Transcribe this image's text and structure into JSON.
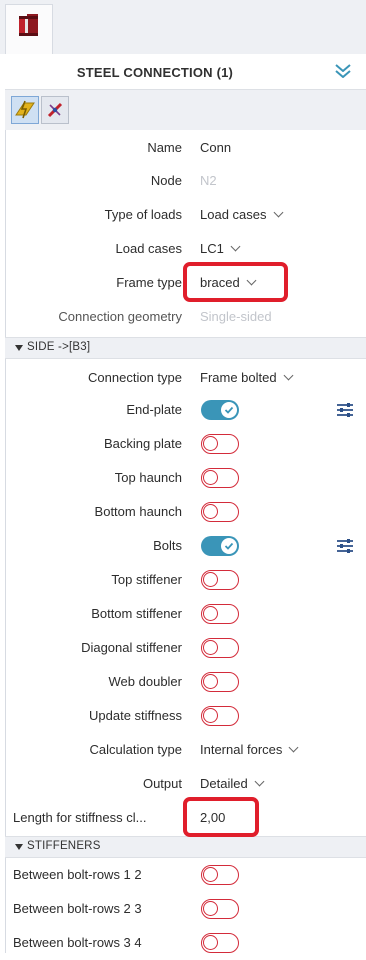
{
  "app": {
    "title": "STEEL CONNECTION (1)",
    "tab_icon": "steel-connection-icon",
    "collapse_icon": "chevron-collapse-icon",
    "accent_color": "#3a95b8",
    "highlight_color": "#e01e2b",
    "off_toggle_color": "#d32b3a"
  },
  "toolbar": {
    "buttons": [
      {
        "icon": "load-icon",
        "active": true
      },
      {
        "icon": "connection-pin-icon",
        "active": false
      }
    ]
  },
  "general": {
    "name": {
      "label": "Name",
      "value": "Conn"
    },
    "node": {
      "label": "Node",
      "value": "N2"
    },
    "type_of_loads": {
      "label": "Type of loads",
      "value": "Load cases"
    },
    "load_cases": {
      "label": "Load cases",
      "value": "LC1"
    },
    "frame_type": {
      "label": "Frame type",
      "value": "braced"
    },
    "connection_geometry": {
      "label": "Connection geometry",
      "value": "Single-sided"
    }
  },
  "side": {
    "header": "SIDE ->[B3]",
    "connection_type": {
      "label": "Connection type",
      "value": "Frame bolted"
    },
    "end_plate": {
      "label": "End-plate",
      "on": true
    },
    "backing_plate": {
      "label": "Backing plate",
      "on": false
    },
    "top_haunch": {
      "label": "Top haunch",
      "on": false
    },
    "bottom_haunch": {
      "label": "Bottom haunch",
      "on": false
    },
    "bolts": {
      "label": "Bolts",
      "on": true
    },
    "top_stiffener": {
      "label": "Top stiffener",
      "on": false
    },
    "bottom_stiffener": {
      "label": "Bottom stiffener",
      "on": false
    },
    "diagonal_stiffener": {
      "label": "Diagonal stiffener",
      "on": false
    },
    "web_doubler": {
      "label": "Web doubler",
      "on": false
    },
    "update_stiffness": {
      "label": "Update stiffness",
      "on": false
    },
    "calculation_type": {
      "label": "Calculation type",
      "value": "Internal forces"
    },
    "output": {
      "label": "Output",
      "value": "Detailed"
    },
    "length_stiffness": {
      "label": "Length for stiffness cl...",
      "value": "2,00"
    }
  },
  "stiffeners": {
    "header": "STIFFENERS",
    "items": [
      {
        "label": "Between bolt-rows 1 2",
        "on": false
      },
      {
        "label": "Between bolt-rows 2 3",
        "on": false
      },
      {
        "label": "Between bolt-rows 3 4",
        "on": false
      }
    ]
  }
}
